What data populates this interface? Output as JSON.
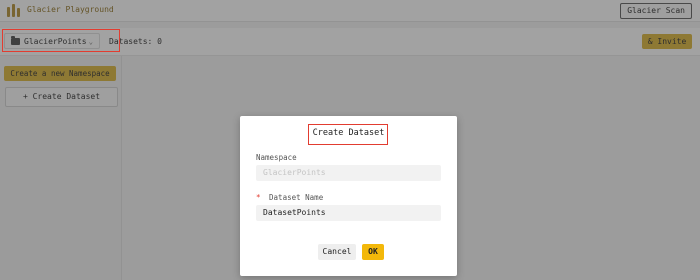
{
  "app": {
    "title": "Glacier Playground",
    "logo_icon": "glacier-logo-icon"
  },
  "header": {
    "scan_label": "Glacier Scan"
  },
  "subheader": {
    "namespace_selected": "GlacierPoints",
    "datasets_count": "Datasets: 0",
    "invite_label": "Invite",
    "invite_icon": "person-icon"
  },
  "sidebar": {
    "create_namespace_label": "Create a new Namespace",
    "create_dataset_label": "Create Dataset",
    "create_dataset_icon": "plus-icon"
  },
  "modal": {
    "title": "Create Dataset",
    "namespace_label": "Namespace",
    "namespace_value": "GlacierPoints",
    "dataset_name_label": "Dataset Name",
    "dataset_name_value": "DatasetPoints",
    "cancel_label": "Cancel",
    "ok_label": "OK"
  },
  "colors": {
    "accent": "#d9b02c",
    "ok_button": "#f3b80a",
    "highlight": "#e23c30"
  }
}
